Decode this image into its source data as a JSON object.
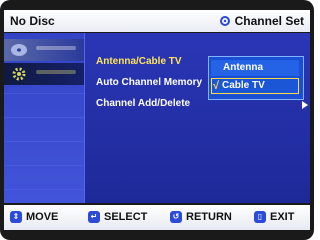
{
  "header": {
    "title": "No Disc",
    "section": "Channel Set"
  },
  "menu": {
    "items": [
      {
        "label": "Antenna/Cable TV"
      },
      {
        "label": "Auto Channel Memory"
      },
      {
        "label": "Channel Add/Delete"
      }
    ]
  },
  "popup": {
    "options": [
      {
        "label": "Antenna"
      },
      {
        "label": "Cable TV"
      }
    ],
    "check": "√"
  },
  "footer": {
    "move": "MOVE",
    "select": "SELECT",
    "return": "RETURN",
    "exit": "EXIT"
  },
  "colors": {
    "accent": "#1e2998",
    "highlight": "#ffe45a",
    "button": "#2c4bd6"
  }
}
